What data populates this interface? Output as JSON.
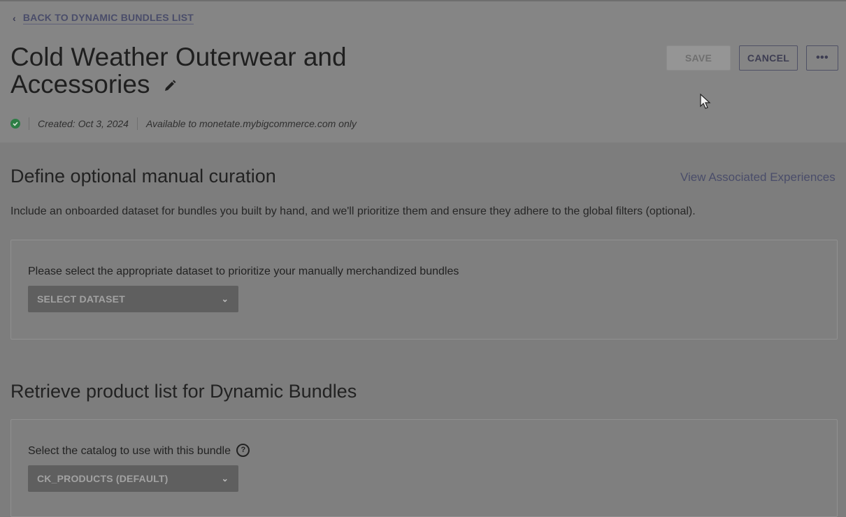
{
  "header": {
    "back_link": "BACK TO DYNAMIC BUNDLES LIST",
    "title_line1": "Cold Weather Outerwear and",
    "title_line2": "Accessories",
    "buttons": {
      "save": "SAVE",
      "cancel": "CANCEL",
      "more": "•••"
    },
    "meta": {
      "status": "active",
      "created": "Created: Oct 3, 2024",
      "availability": "Available to monetate.mybigcommerce.com only"
    }
  },
  "curation": {
    "title": "Define optional manual curation",
    "view_link": "View Associated Experiences",
    "description": "Include an onboarded dataset for bundles you built by hand, and we'll prioritize them and ensure they adhere to the global filters (optional).",
    "dataset_label": "Please select the appropriate dataset to prioritize your manually merchandized bundles",
    "dataset_select": "SELECT DATASET"
  },
  "retrieve": {
    "title": "Retrieve product list for Dynamic Bundles",
    "catalog_label": "Select the catalog to use with this bundle",
    "catalog_select": "CK_PRODUCTS (DEFAULT)"
  },
  "colors": {
    "overlay_bg": "#7d7d7d",
    "link": "#4a4d6a",
    "status_ok": "#2d7d45"
  }
}
